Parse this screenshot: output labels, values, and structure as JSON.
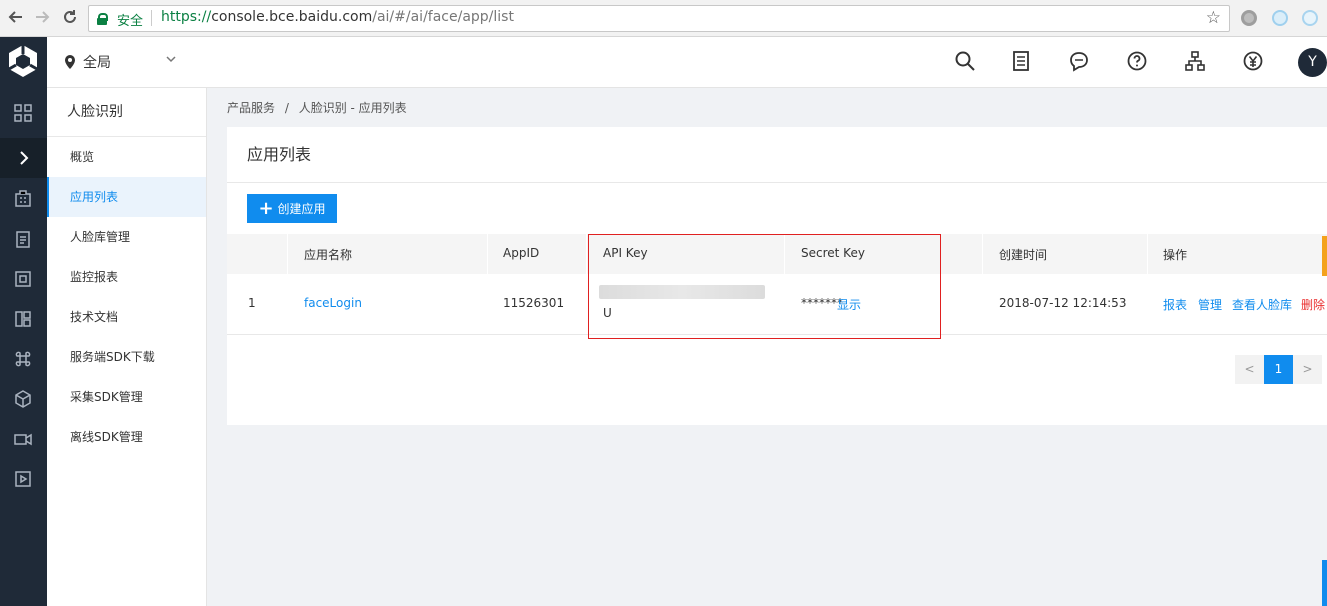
{
  "browser": {
    "secure_label": "安全",
    "url_proto": "https://",
    "url_host": "console.bce.baidu.com",
    "url_path": "/ai/#/ai/face/app/list"
  },
  "header": {
    "region_label": "全局",
    "avatar_initial": "Y"
  },
  "sidebar": {
    "title": "人脸识别",
    "items": [
      {
        "label": "概览"
      },
      {
        "label": "应用列表"
      },
      {
        "label": "人脸库管理"
      },
      {
        "label": "监控报表"
      },
      {
        "label": "技术文档"
      },
      {
        "label": "服务端SDK下载"
      },
      {
        "label": "采集SDK管理"
      },
      {
        "label": "离线SDK管理"
      }
    ]
  },
  "breadcrumb": {
    "root": "产品服务",
    "separator": "/",
    "current": "人脸识别 - 应用列表"
  },
  "main": {
    "title": "应用列表",
    "create_button": "创建应用",
    "columns": [
      "应用名称",
      "AppID",
      "API Key",
      "Secret Key",
      "创建时间",
      "操作"
    ],
    "rows": [
      {
        "index": "1",
        "name": "faceLogin",
        "app_id": "11526301",
        "api_key_tail": "U",
        "secret_mask": "*******",
        "secret_show": "显示",
        "created": "2018-07-12 12:14:53",
        "actions": [
          "报表",
          "管理",
          "查看人脸库",
          "删除"
        ]
      }
    ],
    "pagination": {
      "prev": "<",
      "current": "1",
      "next": ">"
    }
  },
  "colors": {
    "accent": "#108cee",
    "rail_bg": "#1f2a38",
    "danger": "#ea2e2e",
    "highlight_box": "#e02020"
  }
}
